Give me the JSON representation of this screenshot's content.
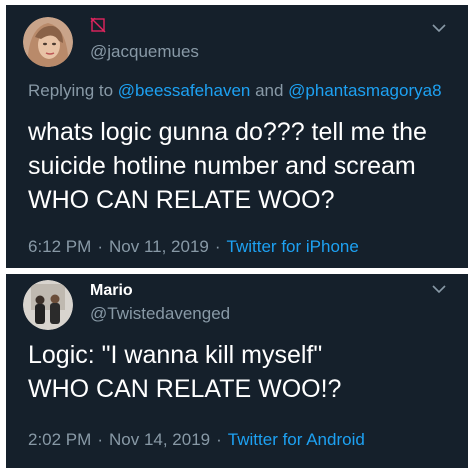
{
  "tweets": [
    {
      "handle": "@jacquemues",
      "reply_prefix": "Replying to ",
      "reply_user1": "@beessafehaven",
      "reply_and": " and ",
      "reply_user2": "@phantasmagorya8",
      "text": "whats logic gunna do??? tell me the suicide hotline number and scream WHO CAN RELATE WOO?",
      "time": "6:12 PM",
      "date": "Nov 11, 2019",
      "source": "Twitter for iPhone",
      "display_name_icon": "crossed-out-frame-icon"
    },
    {
      "display_name": "Mario",
      "handle": "@Twistedavenged",
      "text": "Logic: \"I wanna kill myself\"\nWHO CAN RELATE WOO!?",
      "time": "2:02 PM",
      "date": "Nov 14, 2019",
      "source": "Twitter for Android"
    }
  ],
  "colors": {
    "background": "#15202b",
    "text": "#ffffff",
    "secondary": "#8899a6",
    "link": "#1da1f2"
  }
}
